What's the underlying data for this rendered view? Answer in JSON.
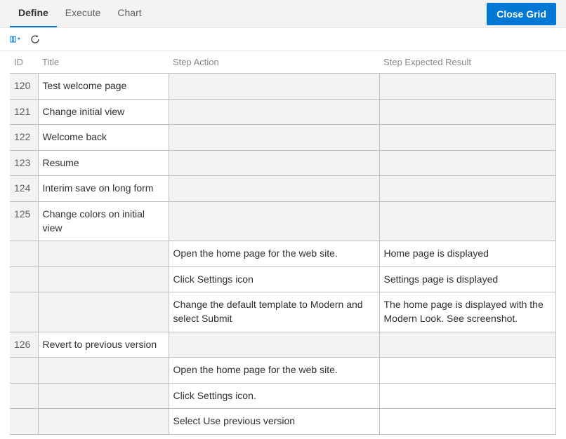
{
  "tabs": [
    {
      "label": "Define",
      "active": true
    },
    {
      "label": "Execute",
      "active": false
    },
    {
      "label": "Chart",
      "active": false
    }
  ],
  "close_button": "Close Grid",
  "columns": {
    "id": "ID",
    "title": "Title",
    "step_action": "Step Action",
    "step_expected": "Step Expected Result"
  },
  "rows": [
    {
      "id": "120",
      "title": "Test welcome page",
      "action": "",
      "expected": ""
    },
    {
      "id": "121",
      "title": "Change initial view",
      "action": "",
      "expected": ""
    },
    {
      "id": "122",
      "title": "Welcome back",
      "action": "",
      "expected": ""
    },
    {
      "id": "123",
      "title": "Resume",
      "action": "",
      "expected": ""
    },
    {
      "id": "124",
      "title": "Interim save on long form",
      "action": "",
      "expected": ""
    },
    {
      "id": "125",
      "title": "Change colors on initial view",
      "action": "",
      "expected": ""
    },
    {
      "id": "",
      "title": "",
      "action": "Open the home page for the web site.",
      "expected": "Home page is displayed"
    },
    {
      "id": "",
      "title": "",
      "action": "Click Settings icon",
      "expected": "Settings page is displayed"
    },
    {
      "id": "",
      "title": "",
      "action": "Change the default template to Modern and select Submit",
      "expected": "The home page is displayed with the Modern Look. See screenshot."
    },
    {
      "id": "126",
      "title": "Revert to previous version",
      "action": "",
      "expected": ""
    },
    {
      "id": "",
      "title": "",
      "action": "Open the home page for the web site.",
      "expected": ""
    },
    {
      "id": "",
      "title": "",
      "action": "Click Settings icon.",
      "expected": ""
    },
    {
      "id": "",
      "title": "",
      "action": "Select Use previous version",
      "expected": ""
    }
  ]
}
